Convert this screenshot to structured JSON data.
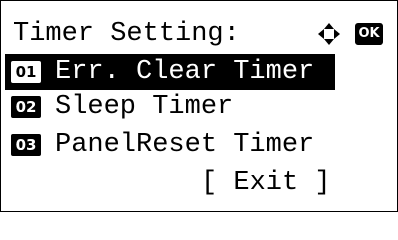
{
  "screen": {
    "title": "Timer Setting:",
    "nav_icon": "four-way-arrows-icon",
    "ok_label": "OK"
  },
  "menu": {
    "items": [
      {
        "num": "01",
        "label": "Err. Clear Timer",
        "selected": true
      },
      {
        "num": "02",
        "label": "Sleep Timer",
        "selected": false
      },
      {
        "num": "03",
        "label": "PanelReset Timer",
        "selected": false
      }
    ]
  },
  "footer": {
    "exit_label": "[ Exit ]"
  }
}
